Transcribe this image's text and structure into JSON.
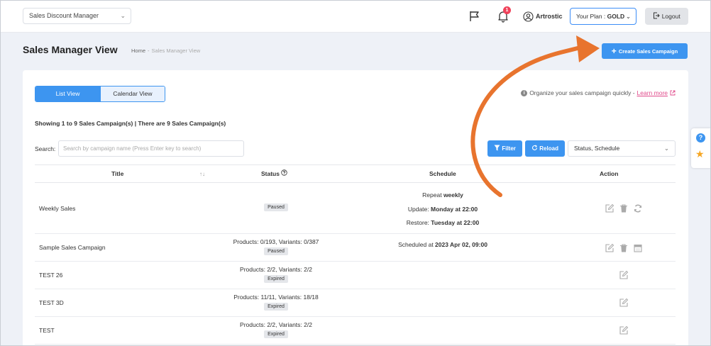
{
  "header": {
    "app_select": "Sales Discount Manager",
    "notification_count": "1",
    "user_name": "Artrostic",
    "plan_label": "Your Plan : ",
    "plan_value": "GOLD",
    "logout_label": "Logout"
  },
  "page": {
    "title": "Sales Manager View",
    "breadcrumb_home": "Home",
    "breadcrumb_sep": "-",
    "breadcrumb_current": "Sales Manager View",
    "create_label": "Create Sales Campaign"
  },
  "view_toggle": {
    "list": "List View",
    "calendar": "Calendar View"
  },
  "organize": {
    "text": "Organize your sales campaign quickly - ",
    "link": "Learn more"
  },
  "showing": "Showing 1 to 9 Sales Campaign(s) | There are 9 Sales Campaign(s)",
  "search": {
    "label": "Search:",
    "placeholder": "Search by campaign name (Press Enter key to search)"
  },
  "controls": {
    "filter": "Filter",
    "reload": "Reload",
    "sort": "Status, Schedule"
  },
  "table": {
    "headers": {
      "title": "Title",
      "status": "Status",
      "schedule": "Schedule",
      "action": "Action"
    },
    "rows": [
      {
        "title": "Weekly Sales",
        "status_text": "",
        "badge": "Paused",
        "schedule_1_pre": "Repeat ",
        "schedule_1_bold": "weekly",
        "schedule_2_pre": "Update: ",
        "schedule_2_bold": "Monday at 22:00",
        "schedule_3_pre": "Restore: ",
        "schedule_3_bold": "Tuesday at 22:00"
      },
      {
        "title": "Sample Sales Campaign",
        "status_text": "Products: 0/193, Variants: 0/387",
        "badge": "Paused",
        "schedule_1_pre": "Scheduled at ",
        "schedule_1_bold": "2023 Apr 02, 09:00"
      },
      {
        "title": "TEST 26",
        "status_text": "Products: 2/2, Variants: 2/2",
        "badge": "Expired"
      },
      {
        "title": "TEST 3D",
        "status_text": "Products: 11/11, Variants: 18/18",
        "badge": "Expired"
      },
      {
        "title": "TEST",
        "status_text": "Products: 2/2, Variants: 2/2",
        "badge": "Expired"
      }
    ]
  },
  "colors": {
    "primary": "#3d95f0",
    "arrow": "#e8742e",
    "badge_red": "#f0425a",
    "link": "#e04a8b"
  }
}
